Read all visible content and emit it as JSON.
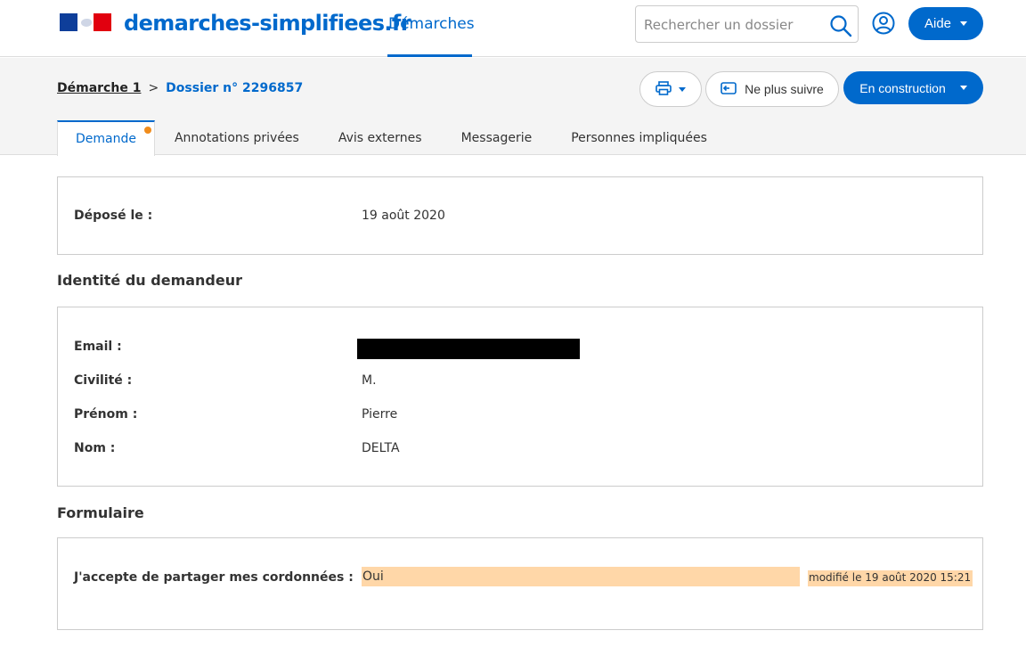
{
  "header": {
    "brand": "demarches-simplifiees.fr",
    "nav_demarches": "Démarches",
    "search_placeholder": "Rechercher un dossier",
    "help_label": "Aide"
  },
  "breadcrumb": {
    "demarche": "Démarche 1",
    "separator": ">",
    "dossier": "Dossier n° 2296857"
  },
  "actions": {
    "unfollow_label": "Ne plus suivre",
    "status_label": "En construction"
  },
  "tabs": [
    {
      "label": "Demande",
      "active": true
    },
    {
      "label": "Annotations privées"
    },
    {
      "label": "Avis externes"
    },
    {
      "label": "Messagerie"
    },
    {
      "label": "Personnes impliquées"
    }
  ],
  "deposit": {
    "label": "Déposé le :",
    "value": "19 août 2020"
  },
  "identity": {
    "title": "Identité du demandeur",
    "email_label": "Email :",
    "civility_label": "Civilité :",
    "civility_value": "M.",
    "firstname_label": "Prénom :",
    "firstname_value": "Pierre",
    "lastname_label": "Nom :",
    "lastname_value": "DELTA"
  },
  "form": {
    "title": "Formulaire",
    "field_label": "J'accepte de partager mes cordonnées :",
    "field_value": "Oui",
    "modified": "modifié le 19 août 2020 15:21"
  },
  "colors": {
    "accent": "#0069cc",
    "notification_dot": "#f08c1c",
    "highlight": "#ffd7a8"
  }
}
